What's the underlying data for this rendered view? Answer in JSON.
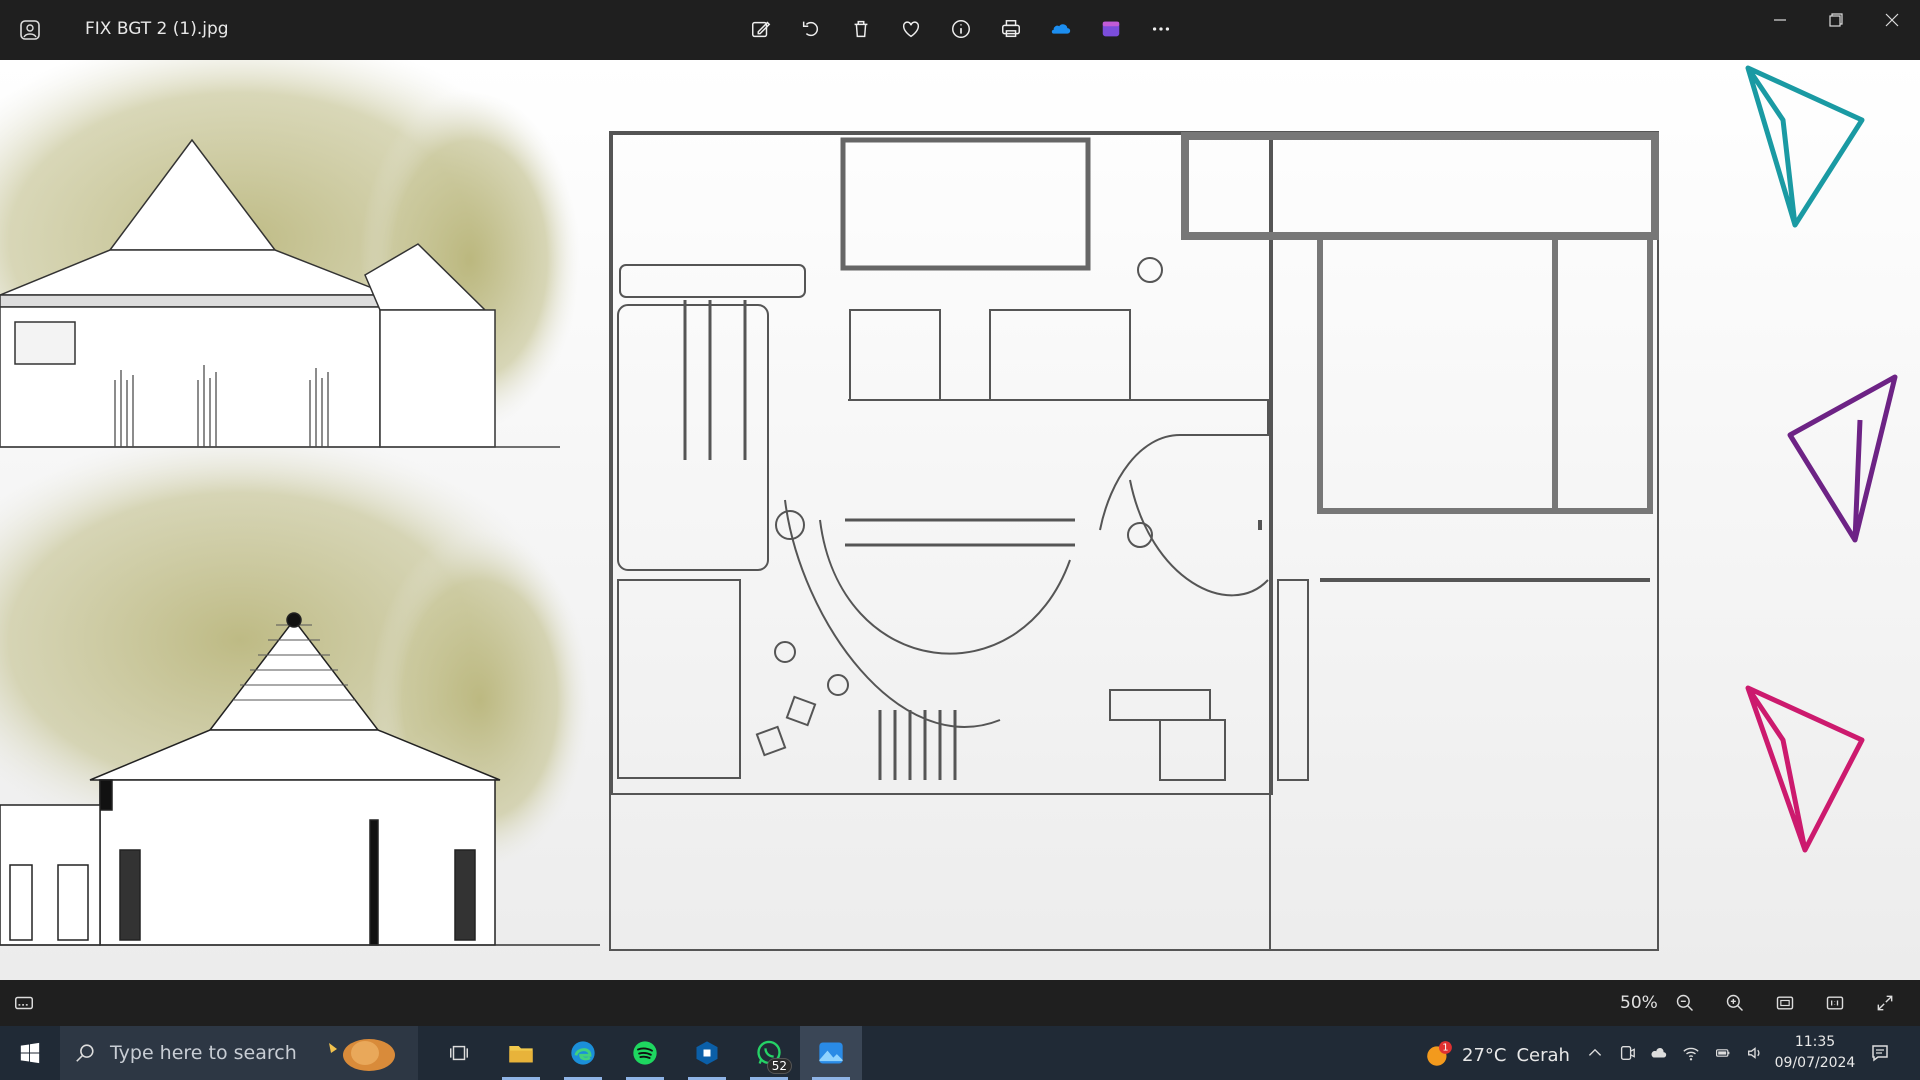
{
  "window": {
    "file_title": "FIX BGT 2 (1).jpg"
  },
  "toolbar": {
    "icons": [
      "edit-image-icon",
      "rotate-icon",
      "delete-icon",
      "favorite-icon",
      "info-icon",
      "print-icon",
      "onedrive-icon",
      "clipchamp-icon",
      "more-icon"
    ]
  },
  "statusbar": {
    "zoom": "50%"
  },
  "taskbar": {
    "search_placeholder": "Type here to search",
    "whatsapp_badge": "52",
    "weather_temp": "27°C",
    "weather_text": "Cerah",
    "time": "11:35",
    "date": "09/07/2024"
  },
  "colors": {
    "titlebar": "#1f1f1f",
    "taskbar": "#202a36",
    "accent_teal": "#1a9aa3",
    "accent_purple": "#6d2385",
    "accent_pink": "#cc1a6e"
  }
}
